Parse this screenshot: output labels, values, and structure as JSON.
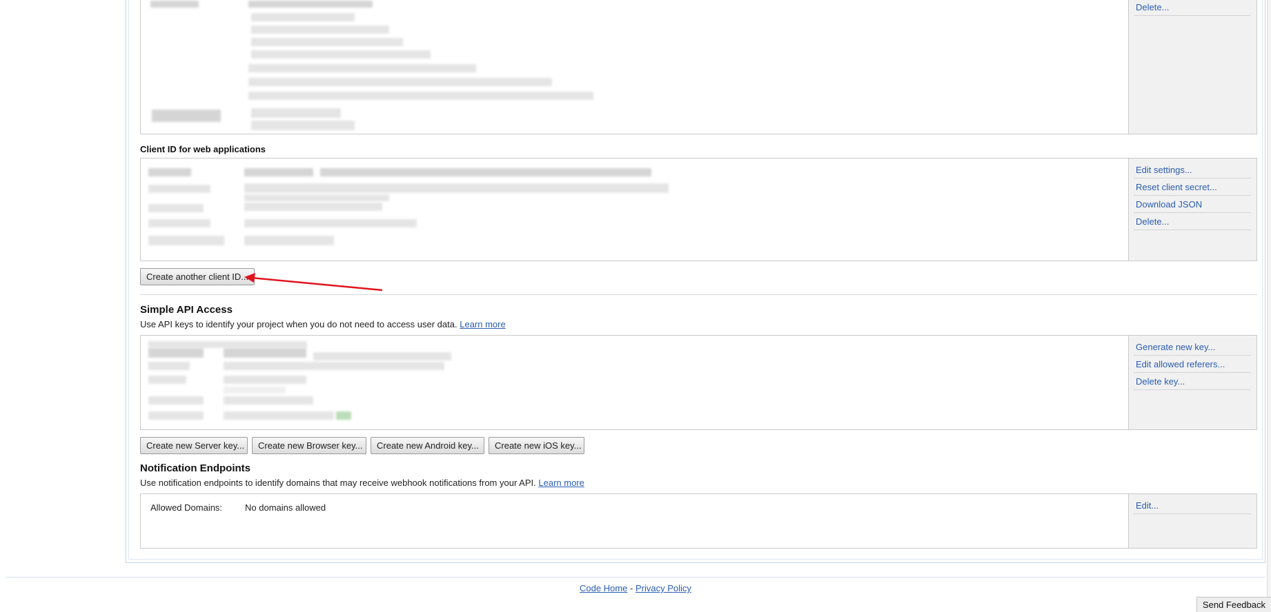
{
  "installed_apps": {
    "side_links": [
      "Delete..."
    ]
  },
  "web_apps": {
    "label": "Client ID for web applications",
    "side_links": [
      "Edit settings...",
      "Reset client secret...",
      "Download JSON",
      "Delete..."
    ],
    "create_button": "Create another client ID..."
  },
  "simple_api": {
    "title": "Simple API Access",
    "description": "Use API keys to identify your project when you do not need to access user data.",
    "learn_more": "Learn more",
    "side_links": [
      "Generate new key...",
      "Edit allowed referers...",
      "Delete key..."
    ],
    "buttons": [
      "Create new Server key...",
      "Create new Browser key...",
      "Create new Android key...",
      "Create new iOS key..."
    ]
  },
  "notifications": {
    "title": "Notification Endpoints",
    "description": "Use notification endpoints to identify domains that may receive webhook notifications from your API.",
    "learn_more": "Learn more",
    "allowed_label": "Allowed Domains:",
    "allowed_value": "No domains allowed",
    "side_links": [
      "Edit..."
    ]
  },
  "footer": {
    "code_home": "Code Home",
    "separator": "-",
    "privacy": "Privacy Policy",
    "send_feedback": "Send Feedback"
  },
  "annotation": {
    "arrow_color": "#e0141e"
  },
  "colors": {
    "link": "#2a5db0",
    "side_panel": "#f1f1f1"
  }
}
